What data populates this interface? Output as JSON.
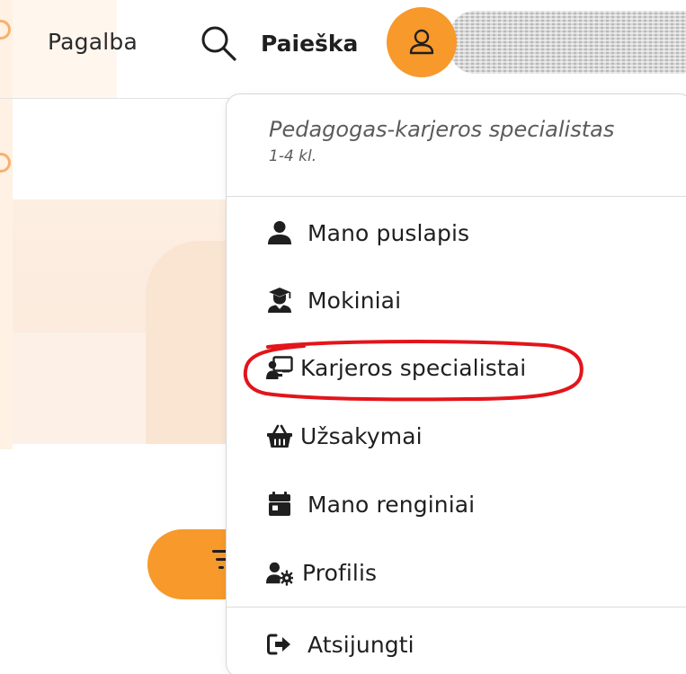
{
  "header": {
    "help_label": "Pagalba",
    "search_label": "Paieška",
    "avatar_icon": "user-icon",
    "user_name_redacted": true
  },
  "dropdown": {
    "role_title": "Pedagogas-karjeros specialistas",
    "role_subtitle": "1-4 kl.",
    "items": [
      {
        "label": "Mano puslapis",
        "icon": "user-icon"
      },
      {
        "label": "Mokiniai",
        "icon": "graduate-icon"
      },
      {
        "label": "Karjeros specialistai",
        "icon": "chalkboard-teacher-icon",
        "highlighted": true
      },
      {
        "label": "Užsakymai",
        "icon": "basket-icon"
      },
      {
        "label": "Mano renginiai",
        "icon": "calendar-icon"
      },
      {
        "label": "Profilis",
        "icon": "user-cog-icon"
      },
      {
        "label": "Atsijungti",
        "icon": "sign-out-icon"
      }
    ]
  },
  "colors": {
    "accent": "#f7992b",
    "highlight_ring": "#e3141b",
    "background_tint": "#fdeee2"
  }
}
